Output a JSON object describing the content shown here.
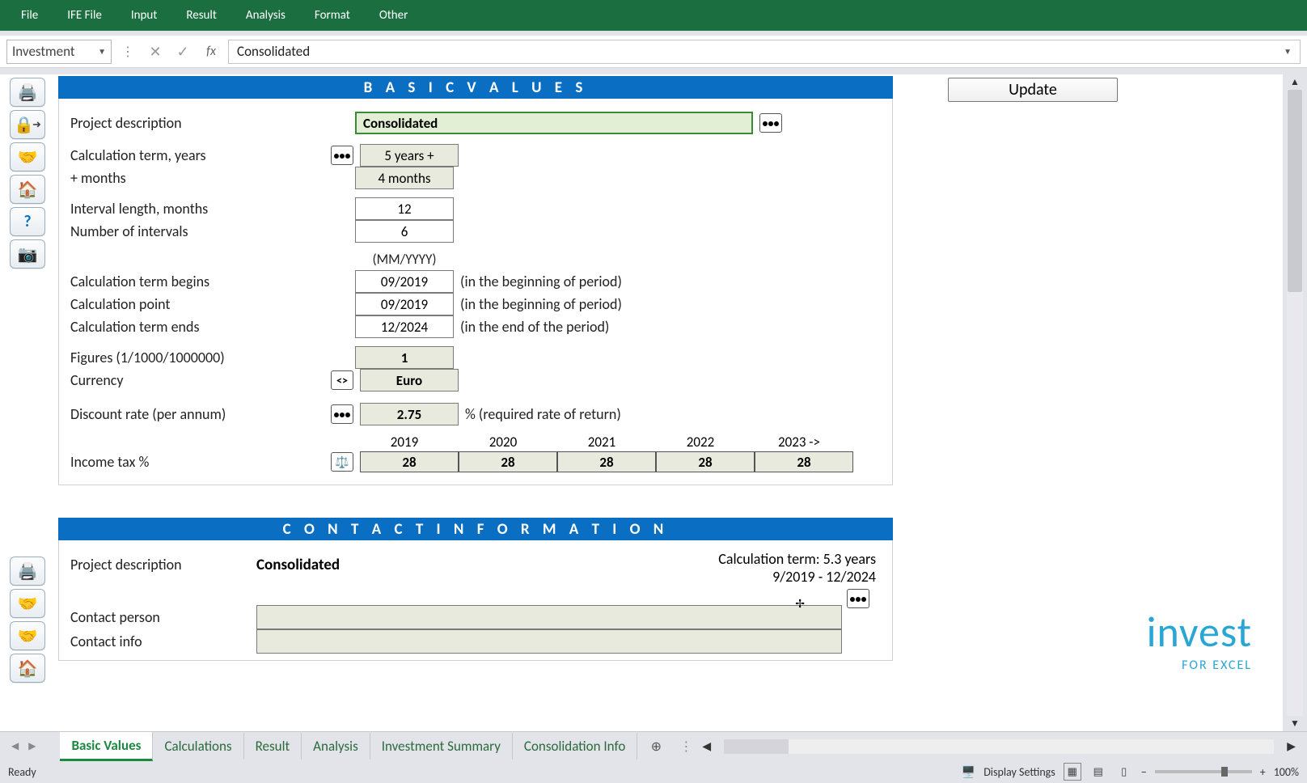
{
  "menu": [
    "File",
    "IFE File",
    "Input",
    "Result",
    "Analysis",
    "Format",
    "Other"
  ],
  "nameBox": "Investment",
  "formulaValue": "Consolidated",
  "toolbar1": {
    "print": "🖨️",
    "key": "🔑",
    "hand": "🤝",
    "home": "🏠",
    "help": "?",
    "camera": "📷"
  },
  "toolbar2": {
    "print": "🖨️",
    "hand": "🤝",
    "hand2": "🤝",
    "home": "🏠"
  },
  "section1": {
    "title": "B A S I C   V A L U E S",
    "updateLabel": "Update",
    "projectDescLabel": "Project description",
    "projectDescValue": "Consolidated",
    "calcTermLabel": "Calculation term, years",
    "calcTermValue": "5 years +",
    "monthsLabel": "+ months",
    "monthsValue": "4 months",
    "intervalLenLabel": "Interval length, months",
    "intervalLenValue": "12",
    "numIntervalsLabel": "Number of intervals",
    "numIntervalsValue": "6",
    "dateHint": "(MM/YYYY)",
    "calcBeginsLabel": "Calculation term begins",
    "calcBeginsValue": "09/2019",
    "calcBeginsNote": "(in the beginning of period)",
    "calcPointLabel": "Calculation point",
    "calcPointValue": "09/2019",
    "calcPointNote": "(in the beginning of period)",
    "calcEndsLabel": "Calculation term ends",
    "calcEndsValue": "12/2024",
    "calcEndsNote": "(in the end of the period)",
    "figuresLabel": "Figures (1/1000/1000000)",
    "figuresValue": "1",
    "currencyLabel": "Currency",
    "currencyValue": "Euro",
    "discountLabel": "Discount rate (per annum)",
    "discountValue": "2.75",
    "discountNote": "%  (required rate of return)",
    "years": [
      "2019",
      "2020",
      "2021",
      "2022",
      "2023 ->"
    ],
    "incomeTaxLabel": "Income tax %",
    "incomeTaxValues": [
      "28",
      "28",
      "28",
      "28",
      "28"
    ]
  },
  "section2": {
    "title": "C O N T A C T   I N F O R M A T I O N",
    "projectDescLabel": "Project description",
    "projectDescValue": "Consolidated",
    "calcTermText": "Calculation term: 5.3 years",
    "dateRange": "9/2019 - 12/2024",
    "contactPersonLabel": "Contact person",
    "contactInfoLabel": "Contact info"
  },
  "brand": {
    "main": "invest",
    "sub": "FOR EXCEL"
  },
  "tabs": [
    "Basic Values",
    "Calculations",
    "Result",
    "Analysis",
    "Investment Summary",
    "Consolidation Info"
  ],
  "activeTab": 0,
  "status": {
    "ready": "Ready",
    "display": "Display Settings",
    "zoom": "100%"
  }
}
